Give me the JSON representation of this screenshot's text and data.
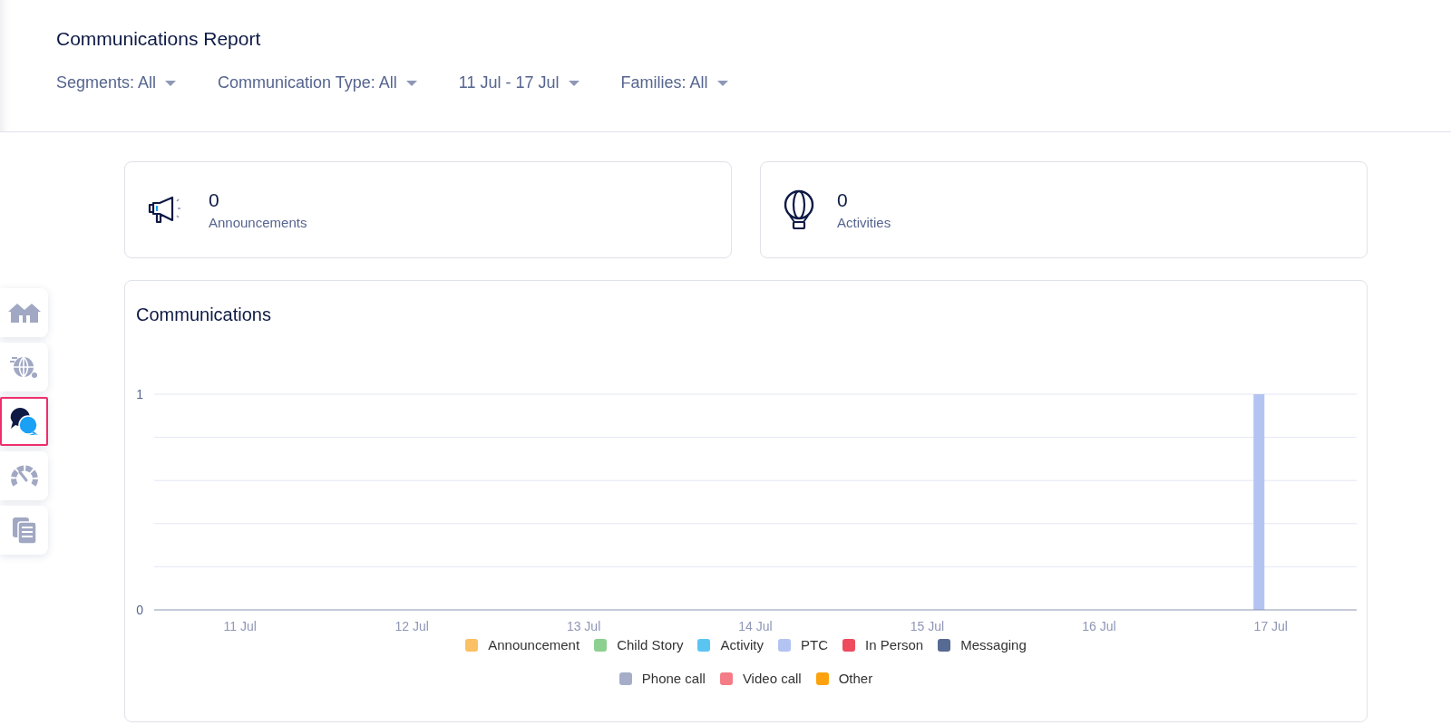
{
  "header": {
    "title": "Communications Report",
    "filters": [
      {
        "label": "Segments: All"
      },
      {
        "label": "Communication Type: All"
      },
      {
        "label": "11 Jul - 17 Jul"
      },
      {
        "label": "Families: All"
      }
    ]
  },
  "sidebar": {
    "items": [
      {
        "selected": false
      },
      {
        "selected": false
      },
      {
        "selected": true
      },
      {
        "selected": false
      },
      {
        "selected": false
      }
    ]
  },
  "stats": [
    {
      "kind": "megaphone",
      "value": "0",
      "label": "Announcements"
    },
    {
      "kind": "balloon",
      "value": "0",
      "label": "Activities"
    }
  ],
  "chart_card": {
    "title": "Communications",
    "chart_data": {
      "type": "bar",
      "categories": [
        "11 Jul",
        "12 Jul",
        "13 Jul",
        "14 Jul",
        "15 Jul",
        "16 Jul",
        "17 Jul"
      ],
      "ylim": [
        0,
        1
      ],
      "yticks": [
        0,
        1
      ],
      "series": [
        {
          "name": "Announcement",
          "color": "#fbc064",
          "values": [
            0,
            0,
            0,
            0,
            0,
            0,
            0
          ]
        },
        {
          "name": "Child Story",
          "color": "#8ccf8e",
          "values": [
            0,
            0,
            0,
            0,
            0,
            0,
            0
          ]
        },
        {
          "name": "Activity",
          "color": "#5bc5f2",
          "values": [
            0,
            0,
            0,
            0,
            0,
            0,
            0
          ]
        },
        {
          "name": "PTC",
          "color": "#b3c3f2",
          "values": [
            0,
            0,
            0,
            0,
            0,
            0,
            1
          ]
        },
        {
          "name": "In Person",
          "color": "#ee4b5f",
          "values": [
            0,
            0,
            0,
            0,
            0,
            0,
            0
          ]
        },
        {
          "name": "Messaging",
          "color": "#566a92",
          "values": [
            0,
            0,
            0,
            0,
            0,
            0,
            0
          ]
        },
        {
          "name": "Phone call",
          "color": "#a5adc8",
          "values": [
            0,
            0,
            0,
            0,
            0,
            0,
            0
          ]
        },
        {
          "name": "Video call",
          "color": "#f47c86",
          "values": [
            0,
            0,
            0,
            0,
            0,
            0,
            0
          ]
        },
        {
          "name": "Other",
          "color": "#fca20e",
          "values": [
            0,
            0,
            0,
            0,
            0,
            0,
            0
          ]
        }
      ]
    }
  }
}
